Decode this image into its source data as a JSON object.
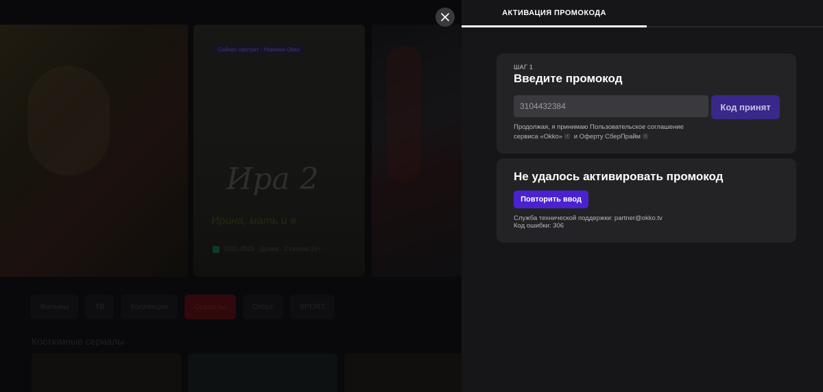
{
  "background": {
    "card_tag": "Сейчас смотрят · Новинки Okko",
    "card_logo": "Ира 2",
    "card_subtitle": "Ирина, мать и я",
    "card_meta": "2022–2025 · Драма · 2 сезона 16+",
    "chips": [
      "Фильмы",
      "ТВ",
      "Коллекции",
      "Сериалы",
      "Спорт",
      "SPORT"
    ],
    "row_title": "Костюмные сериалы"
  },
  "panel": {
    "tab_label": "АКТИВАЦИЯ ПРОМОКОДА",
    "step_label": "ШАГ 1",
    "step_title": "Введите промокод",
    "promo_value": "3104432384",
    "accept_button": "Код принят",
    "terms_line1": "Продолжая, я принимаю Пользовательское соглашение",
    "terms_line2_a": "сервиса «Okko»",
    "terms_line2_b": "и Оферту СберПрайм",
    "error_title": "Не удалось активировать промокод",
    "retry_button": "Повторить ввод",
    "support_text": "Служба технической поддержки: partner@okko.tv",
    "error_code": "Код ошибки: 306"
  },
  "icons": {
    "close": "close-icon",
    "terms_arrow": "chevron-right-icon"
  },
  "colors": {
    "accent_purple": "#4b22d1",
    "accepted_button": "#3a278a"
  }
}
